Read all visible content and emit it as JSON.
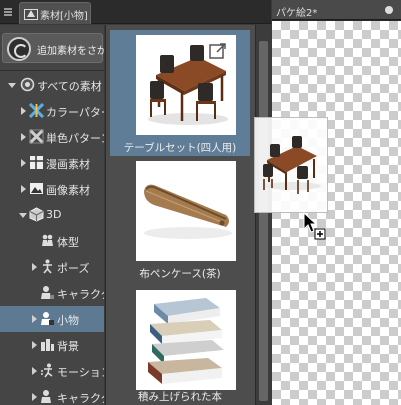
{
  "tabs": {
    "material_tab_label": "素材[小物]",
    "document_tab_label": "パケ絵2*"
  },
  "left_panel": {
    "add_material_button": "追加素材をさがす",
    "tree": [
      {
        "label": "すべての素材",
        "icon": "globe-icon"
      },
      {
        "label": "カラーパターン",
        "icon": "color-pattern-icon"
      },
      {
        "label": "単色パターン",
        "icon": "mono-pattern-icon"
      },
      {
        "label": "漫画素材",
        "icon": "manga-icon"
      },
      {
        "label": "画像素材",
        "icon": "image-icon"
      },
      {
        "label": "3D",
        "icon": "cube-icon"
      },
      {
        "label": "体型",
        "icon": "body-type-icon"
      },
      {
        "label": "ポーズ",
        "icon": "pose-icon"
      },
      {
        "label": "キャラクター",
        "icon": "character-icon"
      },
      {
        "label": "小物",
        "icon": "small-object-icon"
      },
      {
        "label": "背景",
        "icon": "background-icon"
      },
      {
        "label": "モーション",
        "icon": "motion-icon"
      },
      {
        "label": "キャラクター",
        "icon": "character-icon"
      }
    ]
  },
  "thumbnails": [
    {
      "label": "テーブルセット(四人用)",
      "selected": true
    },
    {
      "label": "布ペンケース(茶)",
      "selected": false
    },
    {
      "label": "積み上げられた本",
      "selected": false
    }
  ],
  "colors": {
    "selection": "#5f7d97",
    "panel": "#4d4d4d",
    "tree_bg": "#454545"
  }
}
